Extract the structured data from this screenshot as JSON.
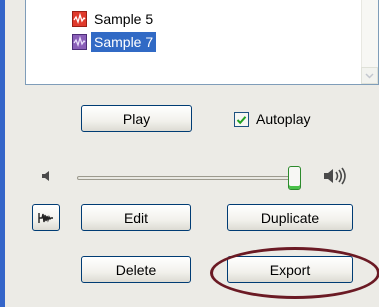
{
  "list": {
    "items": [
      {
        "label": "Sample 5",
        "icon": "red-audio-file-icon",
        "selected": false
      },
      {
        "label": "Sample 7",
        "icon": "purple-audio-file-icon",
        "selected": true
      }
    ]
  },
  "controls": {
    "play_label": "Play",
    "autoplay_label": "Autoplay",
    "autoplay_checked": true,
    "volume_level": 1.0,
    "edit_label": "Edit",
    "duplicate_label": "Duplicate",
    "delete_label": "Delete",
    "export_label": "Export"
  },
  "colors": {
    "selection": "#316ac5",
    "window_border": "#3465c9",
    "highlight_ellipse": "#6b1a24",
    "slider_thumb_accent": "#49c149"
  },
  "icons": {
    "mute": "speaker-low-icon",
    "loud": "speaker-high-icon",
    "waveform_tool": "waveform-icon"
  }
}
